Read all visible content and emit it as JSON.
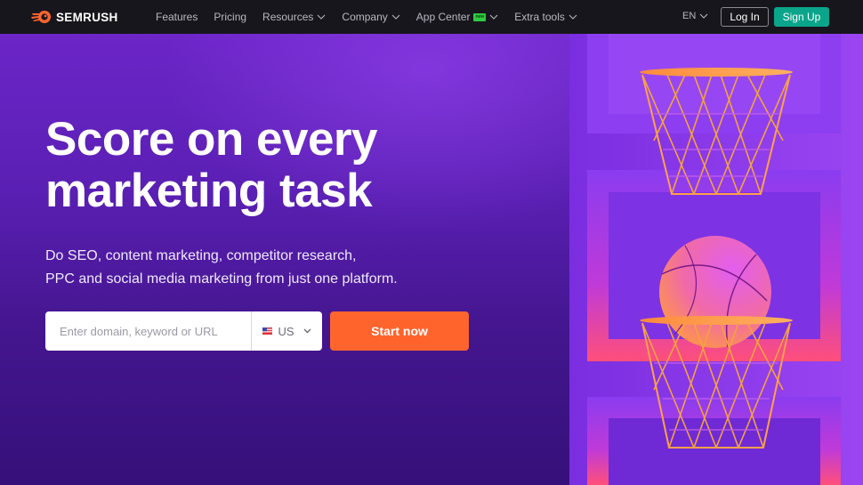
{
  "brand": {
    "name": "SEMRUSH",
    "logo_icon": "flaming-ball-icon",
    "accent_orange": "#ff642d",
    "accent_green": "#0aa58b",
    "hero_purple": "#6c25c8"
  },
  "nav": {
    "items": [
      {
        "label": "Features",
        "has_dropdown": false
      },
      {
        "label": "Pricing",
        "has_dropdown": false
      },
      {
        "label": "Resources",
        "has_dropdown": true
      },
      {
        "label": "Company",
        "has_dropdown": true
      },
      {
        "label": "App Center",
        "has_dropdown": true,
        "badge": "new"
      },
      {
        "label": "Extra tools",
        "has_dropdown": true
      }
    ],
    "language": "EN",
    "login_label": "Log In",
    "signup_label": "Sign Up"
  },
  "hero": {
    "title_line1": "Score on every",
    "title_line2": "marketing task",
    "subtitle_line1": "Do SEO, content marketing, competitor research,",
    "subtitle_line2": "PPC and social media marketing from just one platform.",
    "search": {
      "placeholder": "Enter domain, keyword or URL",
      "value": "",
      "country": "US",
      "country_flag_icon": "us-flag-icon"
    },
    "cta_label": "Start now",
    "illustration": "basketball-hoops-illustration"
  }
}
